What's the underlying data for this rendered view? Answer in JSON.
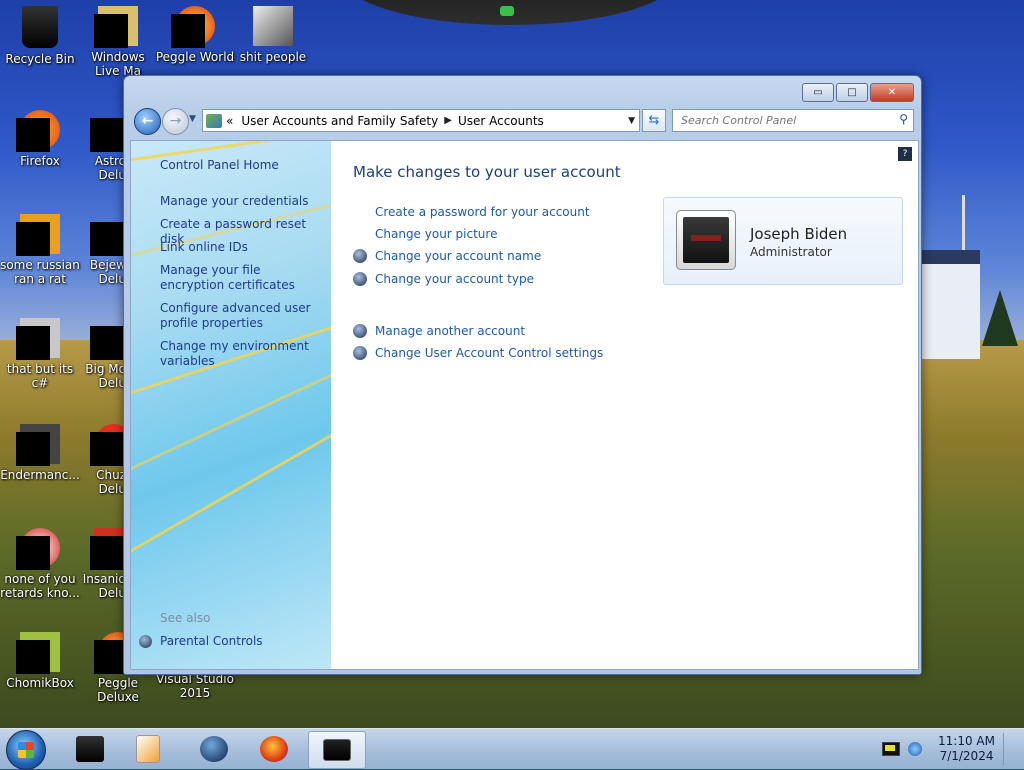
{
  "desktop": {
    "icons": [
      {
        "name": "recycle-bin-icon",
        "label": "Recycle Bin"
      },
      {
        "name": "windows-live-icon",
        "label": "Windows Live Ma"
      },
      {
        "name": "peggle-world-icon",
        "label": "Peggle World"
      },
      {
        "name": "folder-icon",
        "label": "shit people"
      },
      {
        "name": "firefox-icon",
        "label": "Firefox"
      },
      {
        "name": "astro-icon",
        "label": "Astro Delu"
      },
      {
        "name": "app-icon",
        "label": "some russian ran a rat"
      },
      {
        "name": "bejeweled-icon",
        "label": "Bejew Delu"
      },
      {
        "name": "app-icon",
        "label": "that but its c#"
      },
      {
        "name": "big-money-icon",
        "label": "Big Mo Delu"
      },
      {
        "name": "endermanch-icon",
        "label": "Endermanc..."
      },
      {
        "name": "chuzzle-icon",
        "label": "Chuz Delu"
      },
      {
        "name": "app-icon",
        "label": "none of you retards kno..."
      },
      {
        "name": "insaniquarium-icon",
        "label": "Insaniq Delu"
      },
      {
        "name": "chomikbox-icon",
        "label": "ChomikBox"
      },
      {
        "name": "peggle-deluxe-icon",
        "label": "Peggle Deluxe"
      },
      {
        "name": "visual-studio-icon",
        "label": "Visual Studio 2015"
      }
    ]
  },
  "window": {
    "controls": {
      "minimize": "▭",
      "maximize": "□",
      "close": "✕"
    },
    "breadcrumb": {
      "prefix": "«",
      "items": [
        "User Accounts and Family Safety",
        "User Accounts"
      ]
    },
    "search_placeholder": "Search Control Panel",
    "sidebar": {
      "home": "Control Panel Home",
      "links": [
        "Manage your credentials",
        "Create a password reset disk",
        "Link online IDs",
        "Manage your file encryption certificates",
        "Configure advanced user profile properties",
        "Change my environment variables"
      ],
      "see_also_label": "See also",
      "see_also_items": [
        "Parental Controls"
      ]
    },
    "main": {
      "title": "Make changes to your user account",
      "tasks": [
        {
          "label": "Create a password for your account",
          "shield": false
        },
        {
          "label": "Change your picture",
          "shield": false
        },
        {
          "label": "Change your account name",
          "shield": true
        },
        {
          "label": "Change your account type",
          "shield": true
        }
      ],
      "tasks2": [
        {
          "label": "Manage another account",
          "shield": true
        },
        {
          "label": "Change User Account Control settings",
          "shield": true
        }
      ],
      "user": {
        "name": "Joseph Biden",
        "role": "Administrator"
      },
      "help": "?"
    }
  },
  "taskbar": {
    "apps": [
      "unknown-app-icon",
      "media-player-icon",
      "globe-icon",
      "firefox-icon",
      "control-panel-icon"
    ],
    "clock": {
      "time": "11:10 AM",
      "date": "7/1/2024"
    }
  },
  "colors": {
    "link": "#1d5aa8",
    "title": "#1e3f7a"
  }
}
